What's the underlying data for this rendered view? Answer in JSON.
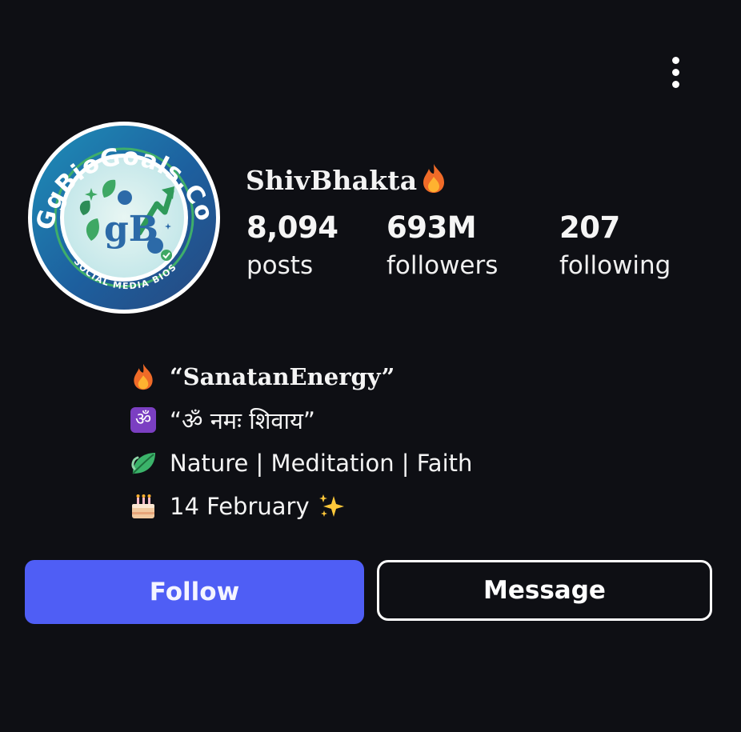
{
  "profile": {
    "username": "ShivBhakta",
    "avatar_ring_text": "GgBioGoals.Com",
    "avatar_bottom_text": "SOCIAL MEDIA BIOS",
    "avatar_monogram": "gB"
  },
  "stats": {
    "posts": {
      "value": "8,094",
      "label": "posts"
    },
    "followers": {
      "value": "693M",
      "label": "followers"
    },
    "following": {
      "value": "207",
      "label": "following"
    }
  },
  "bio": {
    "line1": "“SanatanEnergy”",
    "line2": "“ॐ नमः शिवाय”",
    "line3": "Nature | Meditation | Faith",
    "line4": "14 February",
    "om_symbol": "ॐ"
  },
  "icons": {
    "menu": "more-vertical-icon",
    "fire": "fire-icon",
    "om": "om-icon",
    "leaf": "leaf-icon",
    "cake": "cake-icon",
    "sparkles": "sparkles-icon"
  },
  "buttons": {
    "follow": "Follow",
    "message": "Message"
  },
  "colors": {
    "background": "#0e0f14",
    "follow_button": "#4f5ef5",
    "om_badge": "#7b3fc2"
  }
}
